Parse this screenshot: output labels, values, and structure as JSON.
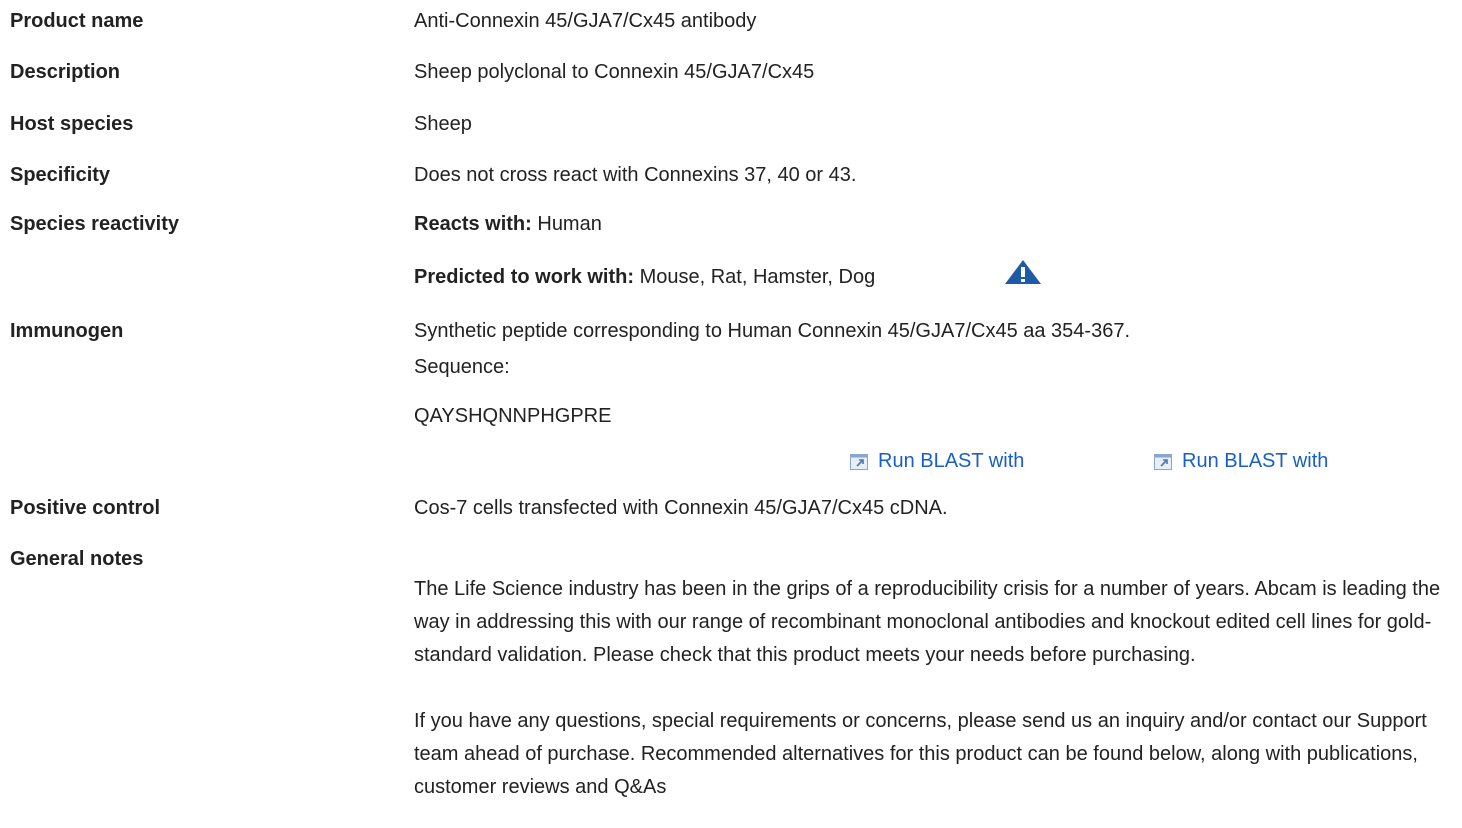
{
  "rows": {
    "product_name": {
      "label": "Product name",
      "value": "Anti-Connexin 45/GJA7/Cx45 antibody"
    },
    "description": {
      "label": "Description",
      "value": "Sheep polyclonal to Connexin 45/GJA7/Cx45"
    },
    "host_species": {
      "label": "Host species",
      "value": "Sheep"
    },
    "specificity": {
      "label": "Specificity",
      "value": "Does not cross react with Connexins 37, 40 or 43."
    },
    "species_reactivity": {
      "label": "Species reactivity",
      "reacts_label": "Reacts with:",
      "reacts_value": " Human",
      "predicted_label": "Predicted to work with:",
      "predicted_value": " Mouse, Rat, Hamster, Dog"
    },
    "immunogen": {
      "label": "Immunogen",
      "line1": "Synthetic peptide corresponding to Human Connexin 45/GJA7/Cx45 aa 354-367.",
      "line2": "Sequence:",
      "sequence": "QAYSHQNNPHGPRE",
      "blast_1": "Run BLAST with",
      "blast_2": "Run BLAST with"
    },
    "positive_control": {
      "label": "Positive control",
      "value": "Cos-7 cells transfected with Connexin 45/GJA7/Cx45 cDNA."
    },
    "general_notes": {
      "label": "General notes",
      "para1": "The Life Science industry has been in the grips of a reproducibility crisis for a number of years. Abcam is leading the way in addressing this with our range of recombinant monoclonal antibodies and knockout edited cell lines for gold-standard validation. Please check that this product meets your needs before purchasing.",
      "para2": "If you have any questions, special requirements or concerns, please send us an inquiry and/or contact our Support team ahead of purchase. Recommended alternatives for this product can be found below, along with publications, customer reviews and Q&As"
    }
  },
  "icons": {
    "warning": "warning-triangle-icon",
    "external": "external-link-icon"
  },
  "colors": {
    "text": "#222222",
    "link": "#1a5fc4",
    "warning": "#1f5aa6"
  }
}
